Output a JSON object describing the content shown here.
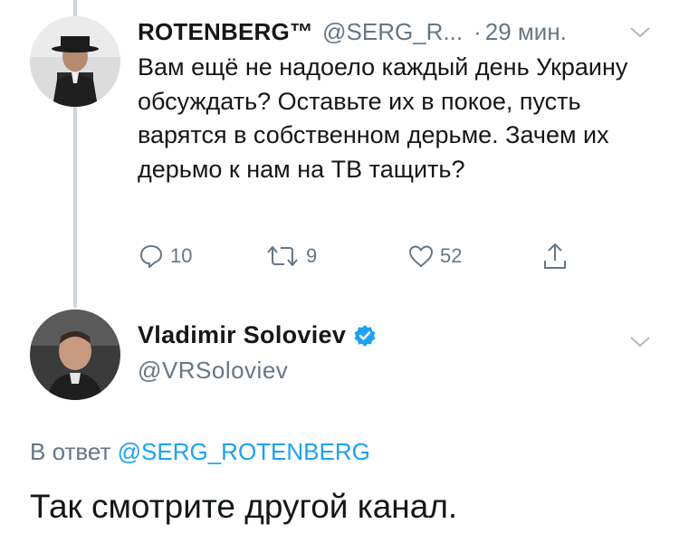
{
  "tweet": {
    "author_name": "ROTENBERG™",
    "author_handle": "@SERG_R...",
    "separator": "·",
    "time": "29 мин.",
    "text": "Вам ещё не надоело каждый день Украину обсуждать? Оставьте их в покое, пусть варятся в собственном дерьме. Зачем их дерьмо к нам на ТВ тащить?",
    "replies": "10",
    "retweets": "9",
    "likes": "52"
  },
  "reply": {
    "author_name": "Vladimir Soloviev",
    "author_handle": "@VRSoloviev",
    "in_reply_prefix": "В ответ",
    "in_reply_mention": "@SERG_ROTENBERG",
    "text": "Так смотрите другой канал."
  },
  "colors": {
    "text": "#14171a",
    "muted": "#657786",
    "accent": "#1da1f2",
    "thread_line": "#ccd6dd"
  },
  "icons": [
    "reply-icon",
    "retweet-icon",
    "like-icon",
    "share-icon",
    "chevron-down-icon",
    "verified-icon"
  ]
}
